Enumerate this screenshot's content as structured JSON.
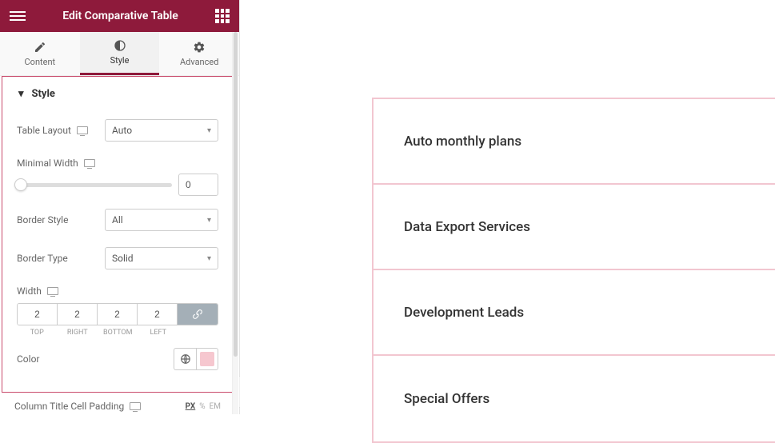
{
  "header": {
    "title": "Edit Comparative Table"
  },
  "tabs": {
    "content": "Content",
    "style": "Style",
    "advanced": "Advanced"
  },
  "section": {
    "title": "Style"
  },
  "controls": {
    "table_layout": {
      "label": "Table Layout",
      "value": "Auto"
    },
    "min_width": {
      "label": "Minimal Width",
      "value": "0"
    },
    "border_style": {
      "label": "Border Style",
      "value": "All"
    },
    "border_type": {
      "label": "Border Type",
      "value": "Solid"
    },
    "width": {
      "label": "Width",
      "top": "2",
      "right": "2",
      "bottom": "2",
      "left": "2",
      "labels": {
        "top": "TOP",
        "right": "RIGHT",
        "bottom": "BOTTOM",
        "left": "LEFT"
      }
    },
    "color": {
      "label": "Color",
      "value": "#f6c7cf"
    },
    "cell_padding": {
      "label": "Column Title Cell Padding",
      "units": {
        "px": "PX",
        "pct": "%",
        "em": "EM"
      }
    }
  },
  "preview": {
    "rows": [
      "Auto monthly plans",
      "Data Export Services",
      "Development Leads",
      "Special Offers"
    ]
  }
}
